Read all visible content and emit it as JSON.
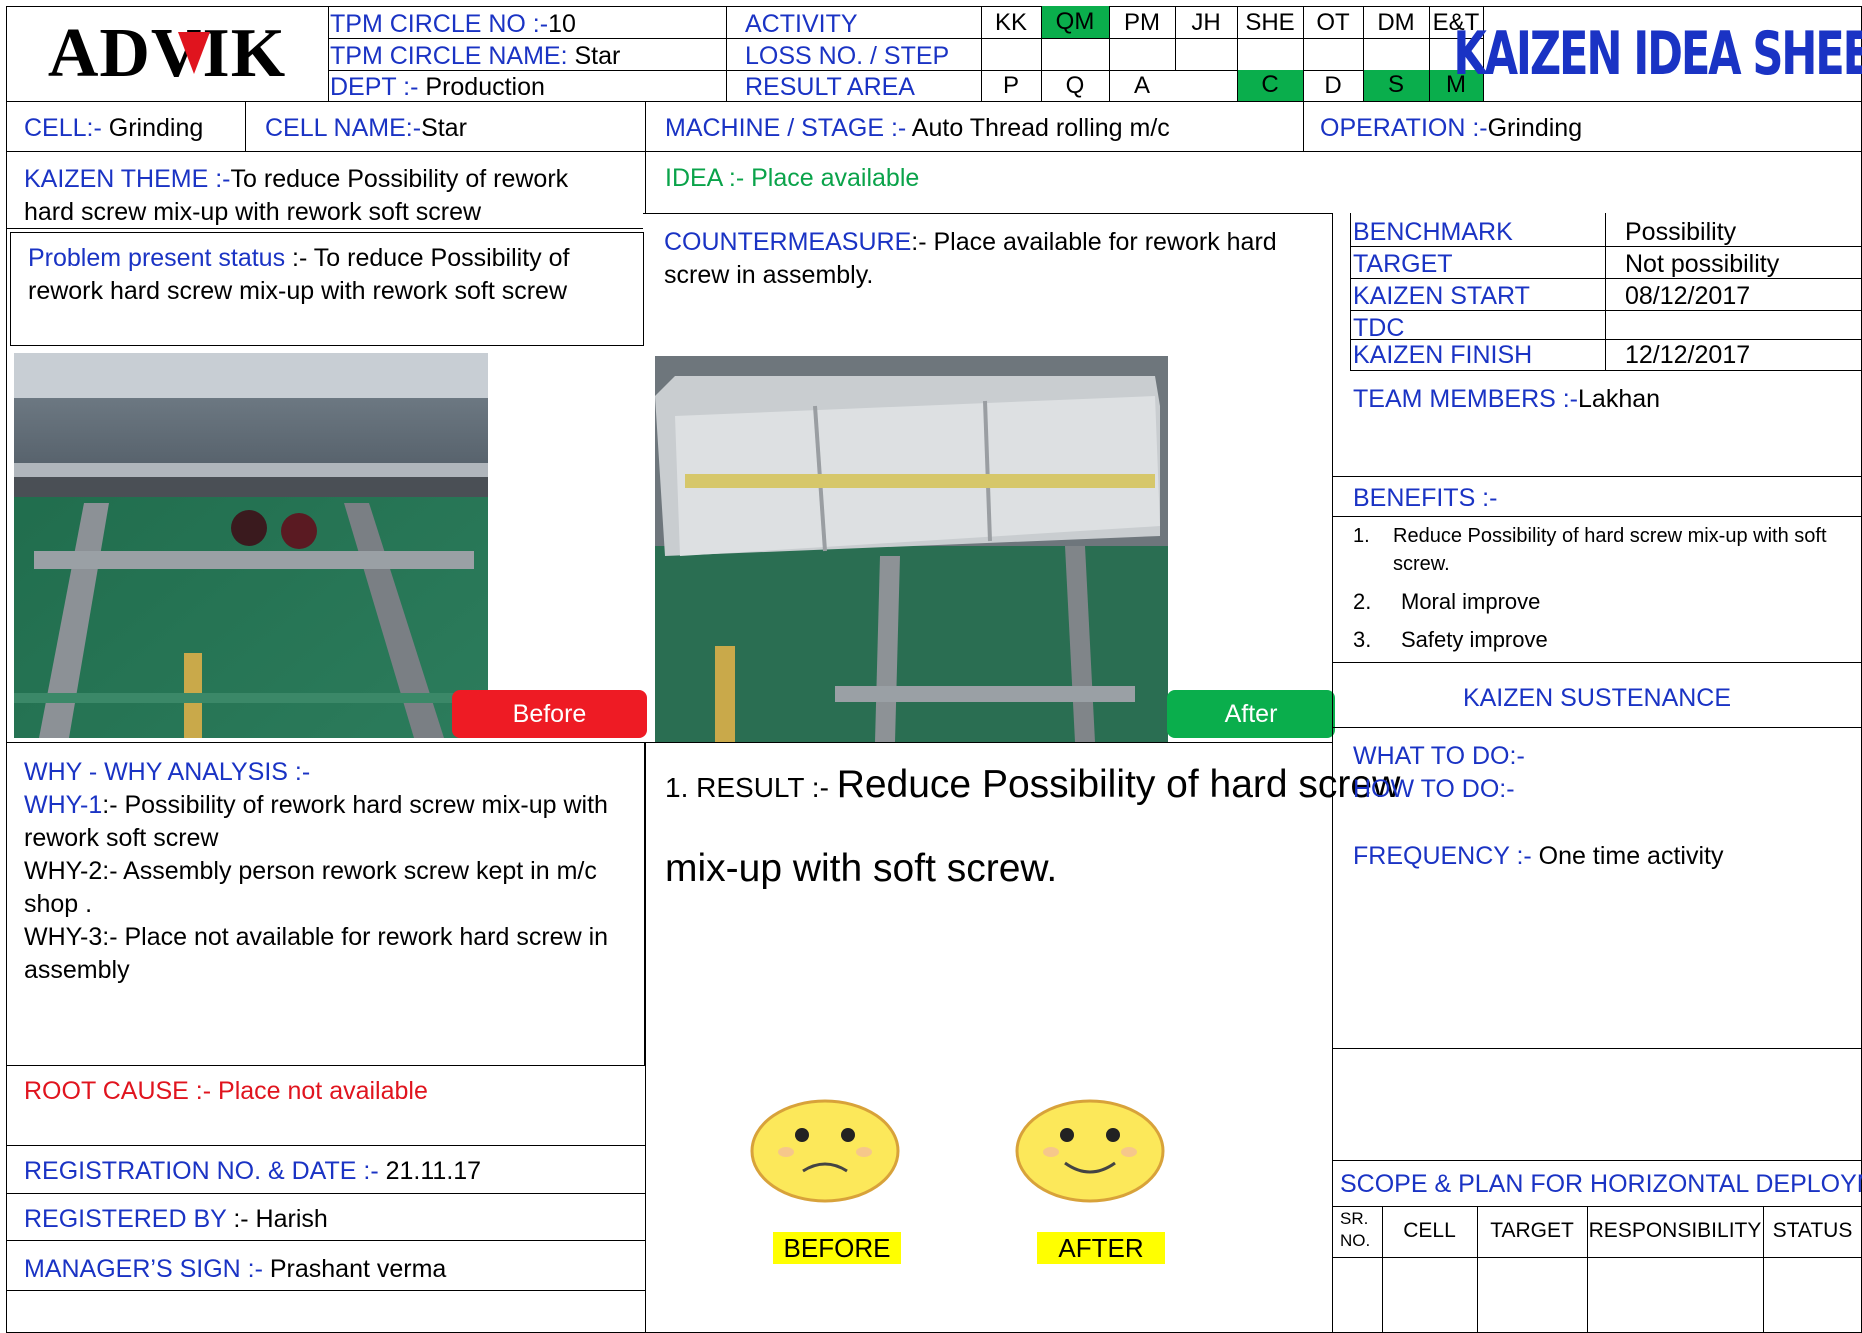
{
  "header": {
    "logo": "ADVIK",
    "circle_no_label": "TPM CIRCLE NO :-",
    "circle_no_value": "10",
    "circle_name_label": "TPM CIRCLE NAME:",
    "circle_name_value": " Star",
    "dept_label": "DEPT :-",
    "dept_value": " Production",
    "activity_label": "ACTIVITY",
    "loss_label": "LOSS NO. / STEP",
    "result_label": "RESULT AREA",
    "activity_codes": [
      "KK",
      "QM",
      "PM",
      "JH",
      "SHE",
      "OT",
      "DM",
      "E&T"
    ],
    "result_codes": [
      "P",
      "Q",
      "A",
      "",
      "C",
      "D",
      "S",
      "M"
    ],
    "sheet_title": "KAIZEN IDEA SHEET"
  },
  "colors": {
    "highlight_green": "#0aae4c",
    "label_blue": "#1a33c4",
    "idea_green": "#0aa34a",
    "root_red": "#e0141e",
    "before_tag": "#ee1b24",
    "after_tag": "#0aae4c"
  },
  "row2": {
    "cell_label": "CELL:-",
    "cell_value": " Grinding",
    "cell_name_label": "CELL NAME:-",
    "cell_name_value": "Star",
    "machine_label": "MACHINE / STAGE  :-",
    "machine_value": " Auto Thread rolling m/c",
    "operation_label": "OPERATION  :-",
    "operation_value": "Grinding"
  },
  "theme": {
    "label": "KAIZEN THEME :-",
    "text": "To reduce Possibility of rework hard screw mix-up with rework soft screw"
  },
  "idea": {
    "label": "IDEA :-",
    "value": " Place available"
  },
  "problem": {
    "label": "Problem present status",
    "text": " :- To reduce Possibility of rework hard screw mix-up with rework soft screw"
  },
  "countermeasure": {
    "label": "COUNTERMEASURE",
    "text": ":- Place available for rework hard screw in assembly."
  },
  "info_table": [
    {
      "label": "BENCHMARK",
      "value": "Possibility"
    },
    {
      "label": "TARGET",
      "value": "Not possibility"
    },
    {
      "label": "KAIZEN START",
      "value": "08/12/2017"
    },
    {
      "label": "TDC",
      "value": ""
    },
    {
      "label": "KAIZEN FINISH",
      "value": "12/12/2017"
    }
  ],
  "team": {
    "label": "TEAM MEMBERS  :-",
    "value": "Lakhan"
  },
  "benefits": {
    "label": "BENEFITS :-",
    "items": [
      {
        "num": "1.",
        "text": " Reduce Possibility of  hard screw mix-up with  soft screw."
      },
      {
        "num": "2.",
        "text": "Moral improve"
      },
      {
        "num": "3.",
        "text": "Safety improve"
      }
    ]
  },
  "photos": {
    "before_tag": "Before",
    "after_tag": "After"
  },
  "sustenance": {
    "title": "KAIZEN SUSTENANCE",
    "what_label": "WHAT TO DO:-",
    "how_label": "HOW TO DO:-",
    "freq_label": "FREQUENCY :-",
    "freq_value": " One time activity"
  },
  "why": {
    "label": "WHY - WHY ANALYSIS :-",
    "why1_label": "WHY-1",
    "why1_text": ":- Possibility of rework hard screw mix-up with rework soft screw",
    "why2": "WHY-2:-  Assembly person rework screw kept in m/c shop .",
    "why3": "WHY-3:-  Place not available for rework hard screw in assembly"
  },
  "result": {
    "prefix": "1.  RESULT :- ",
    "text_line1": "Reduce Possibility of  hard screw",
    "text_line2": "mix-up with  soft screw.",
    "before_label": "BEFORE",
    "after_label": "AFTER"
  },
  "root_cause": {
    "label": "ROOT CAUSE :- ",
    "value": "Place not available"
  },
  "registration": {
    "label": "REGISTRATION NO. & DATE :- ",
    "value": "21.11.17"
  },
  "registered_by": {
    "label": "REGISTERED BY",
    "value": " :- Harish"
  },
  "manager": {
    "label": "MANAGER’S SIGN :-",
    "value": "  Prashant verma"
  },
  "deployment": {
    "title": "SCOPE & PLAN FOR HORIZONTAL DEPLOYMENT",
    "columns": [
      "SR. NO.",
      "CELL",
      "TARGET",
      "RESPONSIBILITY",
      "STATUS"
    ]
  }
}
